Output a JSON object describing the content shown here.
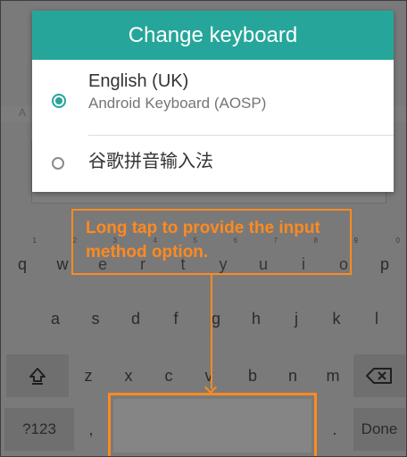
{
  "dialog": {
    "title": "Change keyboard",
    "options": [
      {
        "title": "English (UK)",
        "subtitle": "Android Keyboard (AOSP)",
        "selected": true
      },
      {
        "title": "谷歌拼音输入法",
        "selected": false
      }
    ],
    "accent_color": "#26a69a"
  },
  "background": {
    "field_letter": "A"
  },
  "annotation": {
    "text": "Long tap to provide the input method option.",
    "color": "#ff8a1f"
  },
  "keyboard": {
    "row1": [
      {
        "label": "q",
        "hint": "1"
      },
      {
        "label": "w",
        "hint": "2"
      },
      {
        "label": "e",
        "hint": "3"
      },
      {
        "label": "r",
        "hint": "4"
      },
      {
        "label": "t",
        "hint": "5"
      },
      {
        "label": "y",
        "hint": "6"
      },
      {
        "label": "u",
        "hint": "7"
      },
      {
        "label": "i",
        "hint": "8"
      },
      {
        "label": "o",
        "hint": "9"
      },
      {
        "label": "p",
        "hint": "0"
      }
    ],
    "row2": [
      "a",
      "s",
      "d",
      "f",
      "g",
      "h",
      "j",
      "k",
      "l"
    ],
    "row3": [
      "z",
      "x",
      "c",
      "v",
      "b",
      "n",
      "m"
    ],
    "shift_icon": "shift-arrow-icon",
    "backspace_icon": "backspace-icon",
    "symbols_label": "?123",
    "comma_label": ",",
    "period_label": ".",
    "done_label": "Done"
  }
}
